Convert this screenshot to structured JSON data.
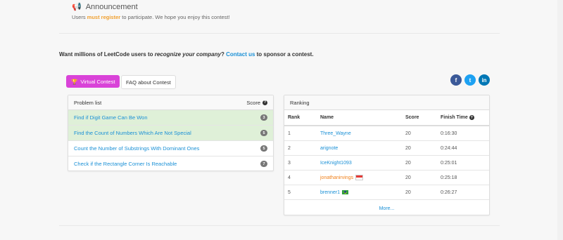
{
  "announcement": {
    "title": "Announcement",
    "text_before": "Users ",
    "text_strong": "must register",
    "text_after": " to participate. We hope you enjoy this contest!"
  },
  "sponsor": {
    "before": "Want millions of LeetCode users to ",
    "emph": "recognize your company",
    "middle": "? ",
    "link": "Contact us",
    "after": " to sponsor a contest."
  },
  "buttons": {
    "virtual": "Virtual Contest",
    "faq": "FAQ about Contest"
  },
  "social": {
    "facebook": "f",
    "twitter": "t",
    "linkedin": "in"
  },
  "problems": {
    "header": "Problem list",
    "score_header": "Score",
    "items": [
      {
        "title": "Find if Digit Game Can Be Won",
        "score": "3",
        "solved": true
      },
      {
        "title": "Find the Count of Numbers Which Are Not Special",
        "score": "5",
        "solved": true
      },
      {
        "title": "Count the Number of Substrings With Dominant Ones",
        "score": "5",
        "solved": false
      },
      {
        "title": "Check if the Rectangle Corner Is Reachable",
        "score": "7",
        "solved": false
      }
    ]
  },
  "ranking": {
    "header": "Ranking",
    "columns": [
      "Rank",
      "Name",
      "Score",
      "Finish Time"
    ],
    "rows": [
      {
        "rank": "1",
        "name": "Three_Wayne",
        "score": "20",
        "time": "0:16:30"
      },
      {
        "rank": "2",
        "name": "arignote",
        "score": "20",
        "time": "0:24:44"
      },
      {
        "rank": "3",
        "name": "IceKnight1093",
        "score": "20",
        "time": "0:25:01"
      },
      {
        "rank": "4",
        "name": "jonathanirvings",
        "score": "20",
        "time": "0:25:18"
      },
      {
        "rank": "5",
        "name": "brenner1",
        "score": "20",
        "time": "0:26:27"
      }
    ],
    "more": "More..."
  },
  "colors": {
    "accent": "#1a90d6",
    "virtual": "#d943d8",
    "solved_bg": "#dff0d8",
    "announce": "#f0a030"
  }
}
